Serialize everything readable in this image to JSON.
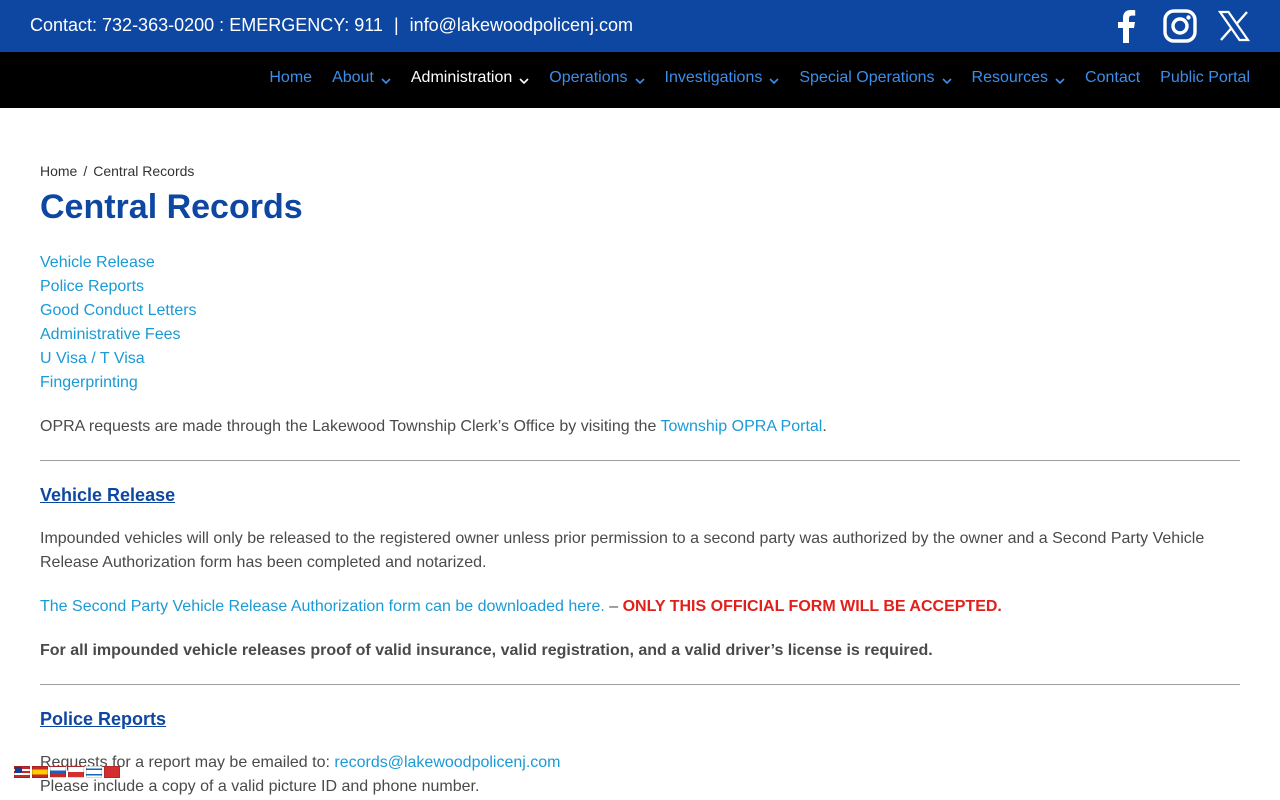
{
  "topbar": {
    "contact_label": "Contact: 732-363-0200",
    "emergency_label": "EMERGENCY: 911",
    "separator1": ":",
    "separator2": "|",
    "email": "info@lakewoodpolicenj.com"
  },
  "social": {
    "facebook_icon": "facebook-icon",
    "instagram_icon": "instagram-icon",
    "x_icon": "x-twitter-icon"
  },
  "nav": {
    "items": [
      {
        "label": "Home",
        "dropdown": false
      },
      {
        "label": "About",
        "dropdown": true
      },
      {
        "label": "Administration",
        "dropdown": true
      },
      {
        "label": "Operations",
        "dropdown": true
      },
      {
        "label": "Investigations",
        "dropdown": true
      },
      {
        "label": "Special Operations",
        "dropdown": true
      },
      {
        "label": "Resources",
        "dropdown": true
      },
      {
        "label": "Contact",
        "dropdown": false
      },
      {
        "label": "Public Portal",
        "dropdown": false
      }
    ],
    "active_index": 2
  },
  "breadcrumb": {
    "home": "Home",
    "separator": "/",
    "current": "Central Records"
  },
  "page_title": "Central Records",
  "quick_links": [
    "Vehicle Release",
    "Police Reports",
    "Good Conduct Letters",
    "Administrative Fees",
    "U Visa / T Visa",
    "Fingerprinting"
  ],
  "opra": {
    "text": "OPRA requests are made through the Lakewood Township Clerk’s Office by visiting the ",
    "link": "Township OPRA Portal",
    "end": "."
  },
  "vehicle_release": {
    "heading": "Vehicle Release",
    "paragraph": "Impounded vehicles will only be released to the registered owner unless prior permission to a second party was authorized by the owner and a Second Party Vehicle Release Authorization form has been completed and notarized.",
    "form_link": "The Second Party Vehicle Release Authorization form can be downloaded here.",
    "dash": " – ",
    "warning": "ONLY THIS OFFICIAL FORM WILL BE ACCEPTED.",
    "requirement": "For all impounded vehicle releases proof of valid insurance, valid registration, and a valid driver’s license is required."
  },
  "police_reports": {
    "heading": "Police Reports",
    "request_text": "Requests for a report may be emailed to: ",
    "email": "records@lakewoodpolicenj.com",
    "id_text": "Please include a copy of a valid picture ID and phone number."
  },
  "colors": {
    "brand_blue": "#0d47a1",
    "link_blue": "#1a9ad6",
    "nav_link": "#3b8eea",
    "warning_red": "#e0201a"
  }
}
